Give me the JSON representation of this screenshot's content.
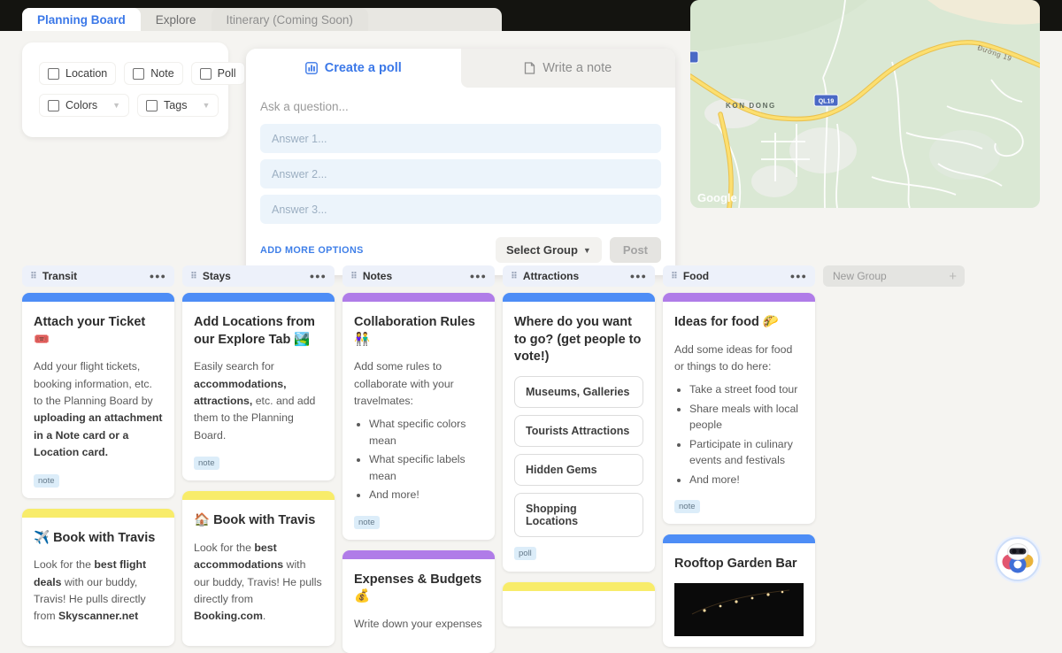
{
  "tabs": [
    {
      "label": "Planning Board"
    },
    {
      "label": "Explore"
    },
    {
      "label": "Itinerary (Coming Soon)"
    }
  ],
  "filters": {
    "row1": [
      "Location",
      "Note",
      "Poll"
    ],
    "row2": [
      "Colors",
      "Tags"
    ]
  },
  "composer": {
    "tab_poll": "Create a poll",
    "tab_note": "Write a note",
    "question_placeholder": "Ask a question...",
    "answers": [
      "Answer 1...",
      "Answer 2...",
      "Answer 3..."
    ],
    "add_more": "ADD MORE OPTIONS",
    "select_group": "Select Group",
    "post": "Post"
  },
  "map": {
    "town": "KON DONG",
    "route_badge": "QL19",
    "road_label": "Đường 19",
    "logo": "Google"
  },
  "board": {
    "new_group_placeholder": "New Group",
    "columns": [
      {
        "name": "Transit",
        "cards": [
          {
            "color": "blue",
            "title": "Attach your Ticket 🎟️",
            "body": [
              {
                "t": "Add your flight tickets, booking information, etc. to the Planning Board by "
              },
              {
                "t": "uploading an attachment in a Note card or a Location card."
              }
            ],
            "tag": "note"
          },
          {
            "color": "yellow",
            "title": "✈️ Book with Travis",
            "body": [
              {
                "t": "Look for the "
              },
              {
                "t": "best flight deals"
              },
              {
                "t": " with our buddy, Travis! He pulls directly from "
              },
              {
                "t": "Skyscanner.net"
              }
            ]
          }
        ]
      },
      {
        "name": "Stays",
        "cards": [
          {
            "color": "blue",
            "title": "Add Locations from our Explore Tab 🏞️",
            "body": [
              {
                "t": "Easily search for "
              },
              {
                "t": "accommodations, attractions,"
              },
              {
                "t": " etc. and add them to the Planning Board."
              }
            ],
            "tag": "note"
          },
          {
            "color": "yellow",
            "title": "🏠 Book with Travis",
            "body": [
              {
                "t": "Look for the "
              },
              {
                "t": "best accommodations"
              },
              {
                "t": " with our buddy, Travis! He pulls directly from "
              },
              {
                "t": "Booking.com"
              },
              {
                "t": "."
              }
            ]
          }
        ]
      },
      {
        "name": "Notes",
        "cards": [
          {
            "color": "purple",
            "title": "Collaboration Rules 👫",
            "intro": "Add some rules to collaborate with your travelmates:",
            "bullets": [
              "What specific colors mean",
              "What specific labels mean",
              "And more!"
            ],
            "tag": "note"
          },
          {
            "color": "purple",
            "title": "Expenses & Budgets 💰",
            "intro": "Write down your expenses"
          }
        ]
      },
      {
        "name": "Attractions",
        "cards": [
          {
            "color": "blue",
            "title": "Where do you want to go? (get people to vote!)",
            "options": [
              "Museums, Galleries",
              "Tourists Attractions",
              "Hidden Gems",
              "Shopping Locations"
            ],
            "tag": "poll"
          },
          {
            "color": "yellow",
            "title": ""
          }
        ]
      },
      {
        "name": "Food",
        "cards": [
          {
            "color": "purple",
            "title": "Ideas for food 🌮",
            "intro": "Add some ideas for food or things to do here:",
            "bullets": [
              "Take a street food tour",
              "Share meals with local people",
              "Participate in culinary events and festivals",
              "And more!"
            ],
            "tag": "note"
          },
          {
            "color": "blue",
            "title": "Rooftop Garden Bar",
            "has_photo": true
          }
        ]
      }
    ]
  },
  "colors": {
    "bar_blue": "#4d8df6",
    "bar_yellow": "#f8ec6a",
    "bar_purple": "#b07ce8",
    "accent_blue": "#3b78e8",
    "map_green": "#dae8d4",
    "route_yellow": "#fcdf70",
    "route_badge_blue": "#4a69c5"
  }
}
